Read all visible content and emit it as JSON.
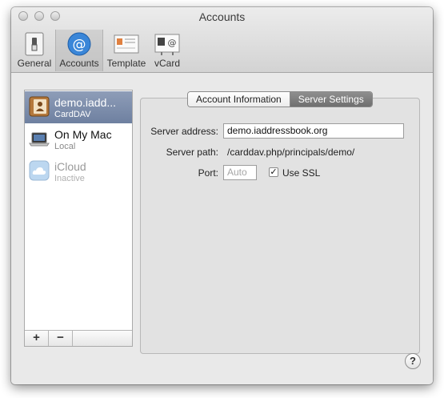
{
  "window": {
    "title": "Accounts"
  },
  "toolbar": {
    "items": [
      {
        "label": "General",
        "icon": "switch-icon"
      },
      {
        "label": "Accounts",
        "icon": "at-sign-icon",
        "selected": true
      },
      {
        "label": "Template",
        "icon": "template-card-icon"
      },
      {
        "label": "vCard",
        "icon": "vcard-icon"
      }
    ]
  },
  "accounts": [
    {
      "name": "demo.iadd...",
      "type": "CardDAV",
      "icon": "address-book-icon",
      "selected": true
    },
    {
      "name": "On My Mac",
      "type": "Local",
      "icon": "laptop-icon"
    },
    {
      "name": "iCloud",
      "type": "Inactive",
      "icon": "cloud-icon",
      "inactive": true
    }
  ],
  "list_footer": {
    "add_label": "+",
    "remove_label": "−"
  },
  "tabs": [
    {
      "label": "Account Information",
      "selected": false
    },
    {
      "label": "Server Settings",
      "selected": true
    }
  ],
  "form": {
    "server_address_label": "Server address:",
    "server_address_value": "demo.iaddressbook.org",
    "server_path_label": "Server path:",
    "server_path_value": "/carddav.php/principals/demo/",
    "port_label": "Port:",
    "port_placeholder": "Auto",
    "use_ssl_label": "Use SSL",
    "use_ssl_checked": true
  },
  "help": {
    "label": "?"
  },
  "colors": {
    "selection": "#7a8aa8",
    "panel": "#e2e2e2",
    "window": "#ececec"
  }
}
